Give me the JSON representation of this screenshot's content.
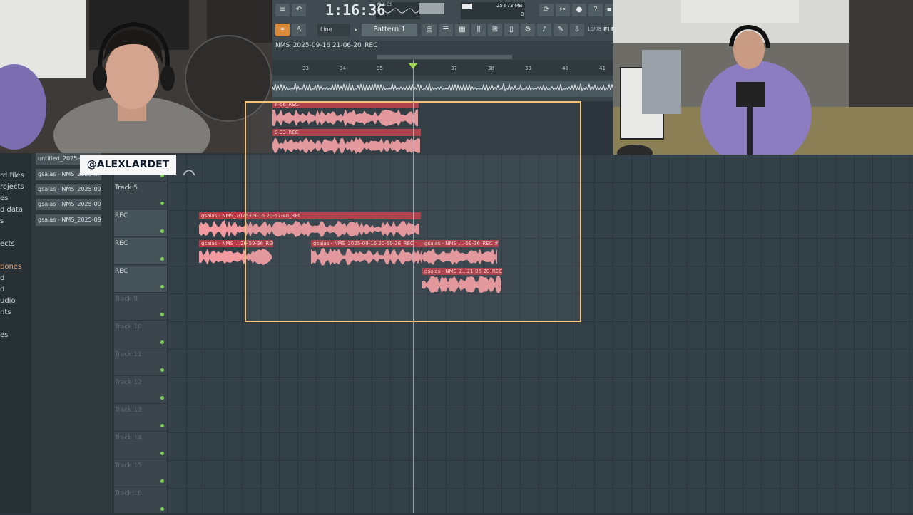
{
  "app": {
    "name": "FL Studio"
  },
  "toolbar": {
    "time": "1:16:36",
    "time_unit": "M:S:CS",
    "memory": "673 MB",
    "cpu": "25",
    "polyphony": "0",
    "snap": "Line",
    "pattern": "Pattern 1",
    "status_tag": "10/08",
    "fl_label": "FLE"
  },
  "playlist": {
    "title": "NMS_2025-09-16 21-06-20_REC",
    "ruler": [
      "33",
      "34",
      "35",
      "37",
      "38",
      "39",
      "40",
      "41"
    ],
    "tracks": [
      {
        "name": "Track 5",
        "state": "on"
      },
      {
        "name": "REC",
        "state": "on"
      },
      {
        "name": "REC",
        "state": "on"
      },
      {
        "name": "REC",
        "state": "on"
      },
      {
        "name": "Track 9",
        "state": "off"
      },
      {
        "name": "Track 10",
        "state": "off"
      },
      {
        "name": "Track 11",
        "state": "off"
      },
      {
        "name": "Track 12",
        "state": "off"
      },
      {
        "name": "Track 13",
        "state": "off"
      },
      {
        "name": "Track 14",
        "state": "off"
      },
      {
        "name": "Track 15",
        "state": "off"
      },
      {
        "name": "Track 16",
        "state": "off"
      }
    ],
    "clips": {
      "top1": "6-56_REC",
      "top2": "9-33_REC",
      "c1": "gsaias - NMS_2025-09-16 20-57-40_REC",
      "c2": "gsaias - NMS_...20-59-36_REC",
      "c3": "gsaias - NMS_2025-09-16 20-59-36_REC",
      "c4": "gsaias - NMS_...-59-36_REC #2",
      "c5": "gsaias - NMS_2...21-06-20_REC"
    }
  },
  "browser": {
    "categories": [
      {
        "label": "rd files",
        "highlight": false
      },
      {
        "label": "rojects",
        "highlight": false
      },
      {
        "label": "es",
        "highlight": false
      },
      {
        "label": "d data",
        "highlight": false
      },
      {
        "label": "s",
        "highlight": false
      },
      {
        "label": "ects",
        "highlight": false
      },
      {
        "label": "bones",
        "highlight": true
      },
      {
        "label": "d",
        "highlight": false
      },
      {
        "label": "d",
        "highlight": false
      },
      {
        "label": "udio",
        "highlight": false
      },
      {
        "label": "nts",
        "highlight": false
      },
      {
        "label": "es",
        "highlight": false
      }
    ],
    "files": [
      "untitled_2025-09-...",
      "gsaias - NMS_2025-...",
      "gsaias - NMS_2025-09-1...",
      "gsaias - NMS_2025-09-1...",
      "gsaias - NMS_2025-09-1..."
    ]
  },
  "overlay": {
    "tag": "@ALEXLARDET"
  }
}
